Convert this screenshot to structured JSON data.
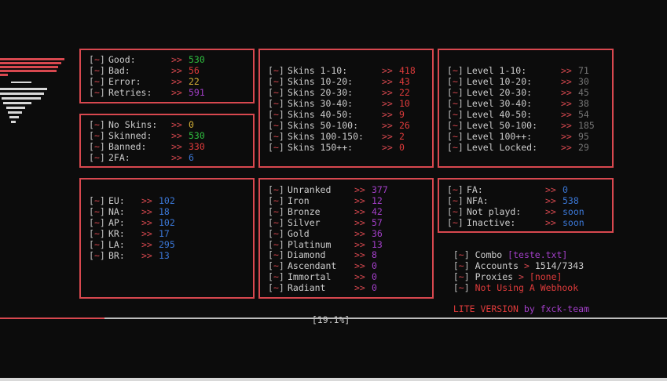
{
  "colors": {
    "border": "#d8484f",
    "bg": "#0c0c0c",
    "text": "#cccccc",
    "green": "#2fbf3f",
    "red": "#e03b3b",
    "orange": "#d7b237",
    "purple": "#a33fc9",
    "blue": "#3b78d8",
    "gray": "#767676"
  },
  "prefix": {
    "open": "[",
    "tilde": "~",
    "close": "]"
  },
  "arrow": ">>",
  "stats": [
    {
      "label": "Good:",
      "value": "530",
      "color": "green"
    },
    {
      "label": "Bad:",
      "value": "56",
      "color": "red"
    },
    {
      "label": "Error:",
      "value": "22",
      "color": "orange"
    },
    {
      "label": "Retries:",
      "value": "591",
      "color": "purple"
    }
  ],
  "skin_status": [
    {
      "label": "No Skins:",
      "value": "0",
      "color": "yellow"
    },
    {
      "label": "Skinned:",
      "value": "530",
      "color": "green"
    },
    {
      "label": "Banned:",
      "value": "330",
      "color": "red"
    },
    {
      "label": "2FA:",
      "value": "6",
      "color": "blue"
    }
  ],
  "regions": [
    {
      "label": "EU:",
      "value": "102"
    },
    {
      "label": "NA:",
      "value": "18"
    },
    {
      "label": "AP:",
      "value": "102"
    },
    {
      "label": "KR:",
      "value": "17"
    },
    {
      "label": "LA:",
      "value": "295"
    },
    {
      "label": "BR:",
      "value": "13"
    }
  ],
  "skins": [
    {
      "label": "Skins 1-10:",
      "value": "418"
    },
    {
      "label": "Skins 10-20:",
      "value": "43"
    },
    {
      "label": "Skins 20-30:",
      "value": "22"
    },
    {
      "label": "Skins 30-40:",
      "value": "10"
    },
    {
      "label": "Skins 40-50:",
      "value": "9"
    },
    {
      "label": "Skins 50-100:",
      "value": "26"
    },
    {
      "label": "Skins 100-150:",
      "value": "2"
    },
    {
      "label": "Skins 150++:",
      "value": "0"
    }
  ],
  "ranks": [
    {
      "label": "Unranked",
      "value": "377"
    },
    {
      "label": "Iron",
      "value": "12"
    },
    {
      "label": "Bronze",
      "value": "42"
    },
    {
      "label": "Silver",
      "value": "57"
    },
    {
      "label": "Gold",
      "value": "36"
    },
    {
      "label": "Platinum",
      "value": "13"
    },
    {
      "label": "Diamond",
      "value": "8"
    },
    {
      "label": "Ascendant",
      "value": "0"
    },
    {
      "label": "Immortal",
      "value": "0"
    },
    {
      "label": "Radiant",
      "value": "0"
    }
  ],
  "levels": [
    {
      "label": "Level 1-10:",
      "value": "71"
    },
    {
      "label": "Level 10-20:",
      "value": "30"
    },
    {
      "label": "Level 20-30:",
      "value": "45"
    },
    {
      "label": "Level 30-40:",
      "value": "38"
    },
    {
      "label": "Level 40-50:",
      "value": "54"
    },
    {
      "label": "Level 50-100:",
      "value": "185"
    },
    {
      "label": "Level 100++:",
      "value": "95"
    },
    {
      "label": "Level Locked:",
      "value": "29"
    }
  ],
  "access": [
    {
      "label": "FA:",
      "value": "0"
    },
    {
      "label": "NFA:",
      "value": "538"
    },
    {
      "label": "Not playd:",
      "value": "soon"
    },
    {
      "label": "Inactive:",
      "value": "soon"
    }
  ],
  "info": {
    "combo_label": "Combo",
    "combo_value": "[teste.txt]",
    "accounts_label": "Accounts",
    "accounts_arrow": ">",
    "accounts_value": "1514/7343",
    "proxies_label": "Proxies",
    "proxies_arrow": ">",
    "proxies_value": "[none]",
    "webhook": "Not Using A Webhook",
    "version": "LITE VERSION",
    "by": "by",
    "team": "fxck-team"
  },
  "progress": {
    "text": "[19.1%]",
    "percent": 19.1
  }
}
